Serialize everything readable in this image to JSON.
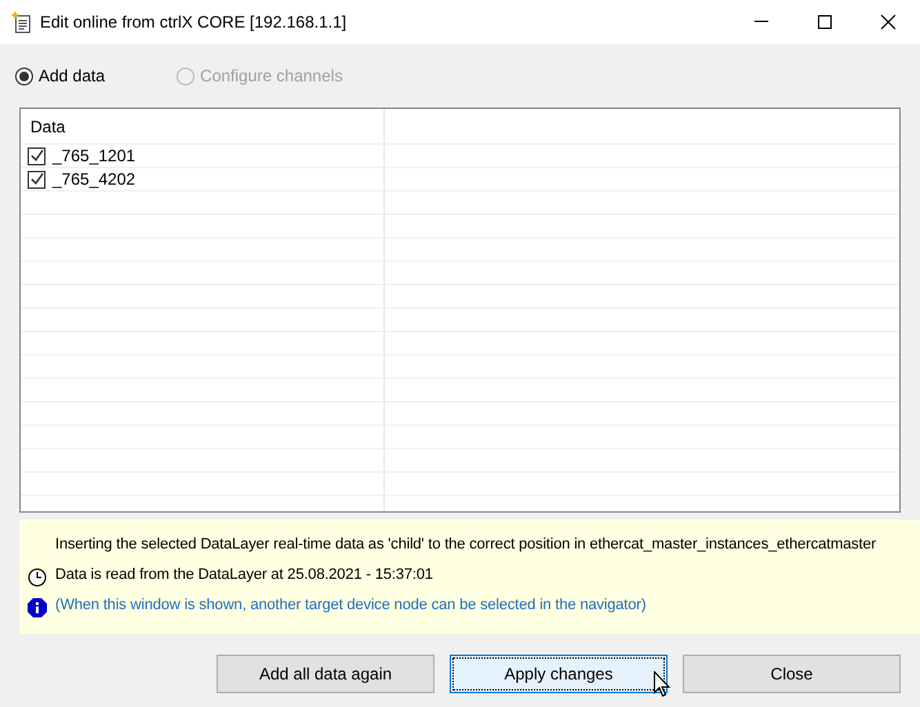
{
  "window": {
    "title": "Edit online from ctrlX CORE [192.168.1.1]"
  },
  "modes": [
    {
      "label": "Add data",
      "selected": true,
      "disabled": false
    },
    {
      "label": "Configure channels",
      "selected": false,
      "disabled": true
    }
  ],
  "table": {
    "columns": [
      "Data"
    ],
    "rows": [
      {
        "label": "_765_1201",
        "checked": true
      },
      {
        "label": "_765_4202",
        "checked": true
      }
    ]
  },
  "messages": [
    {
      "kind": "text",
      "text": "Inserting the selected DataLayer real-time data as 'child' to the correct position in ethercat_master_instances_ethercatmaster"
    },
    {
      "kind": "clock",
      "text": "Data is read from the DataLayer at  25.08.2021 - 15:37:01"
    },
    {
      "kind": "info",
      "text": "(When this window is shown, another target device node can be selected in the navigator)"
    }
  ],
  "buttons": [
    {
      "label": "Add all data again",
      "focused": false
    },
    {
      "label": "Apply changes",
      "focused": true
    },
    {
      "label": "Close",
      "focused": false
    }
  ]
}
